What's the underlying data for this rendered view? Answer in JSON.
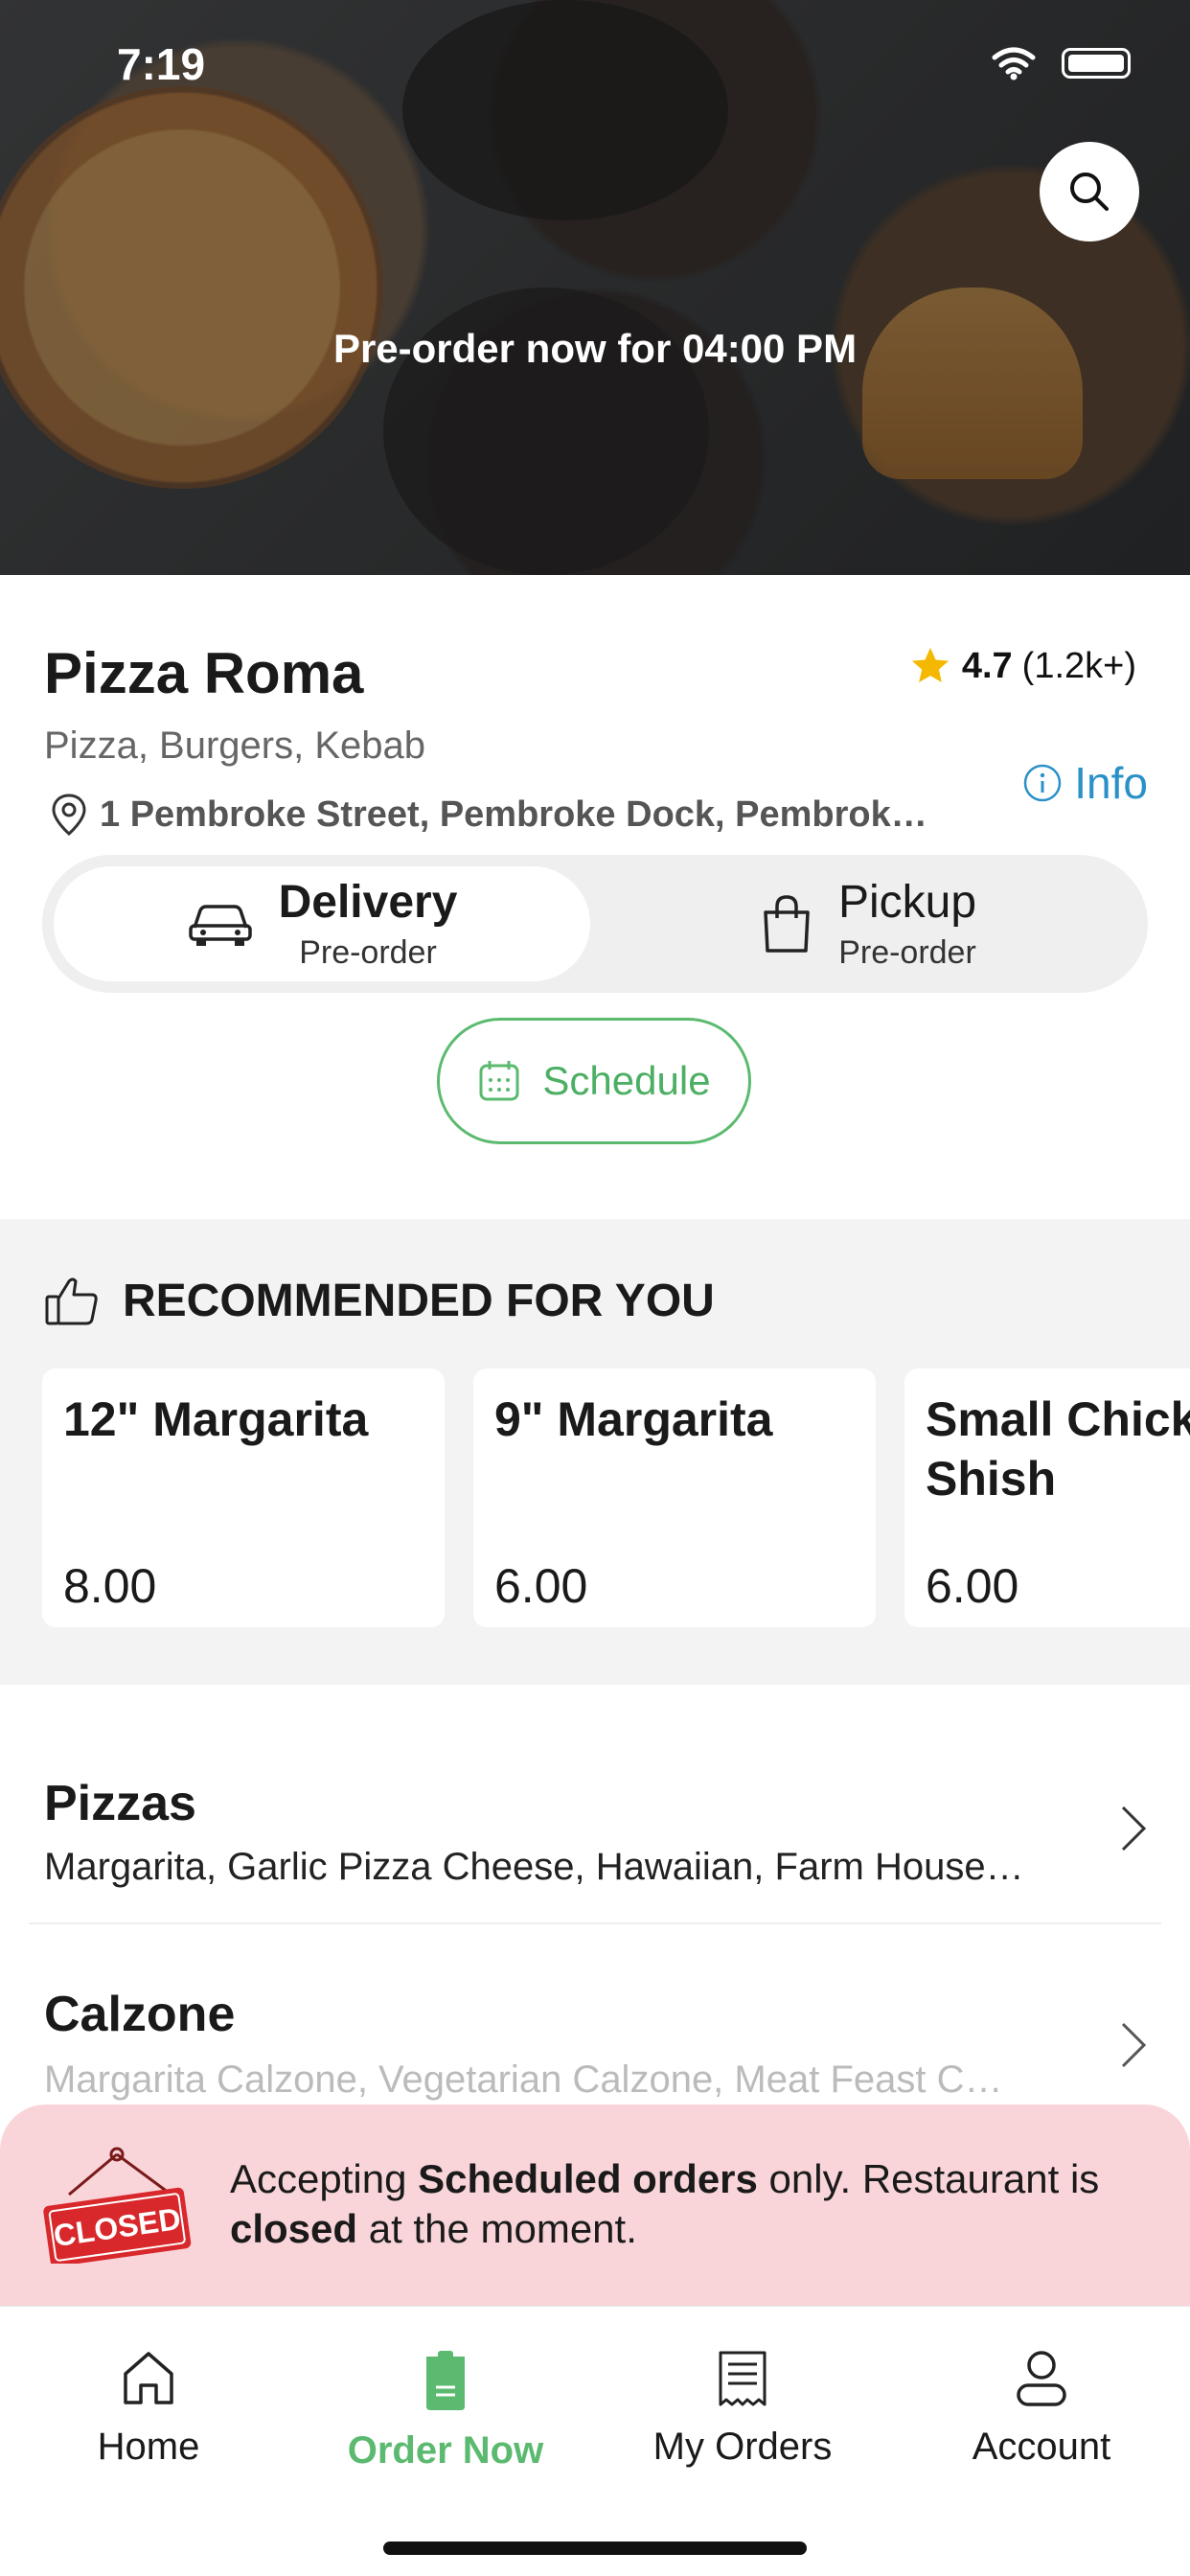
{
  "status": {
    "time": "7:19"
  },
  "hero": {
    "title": "Pre-order now for 04:00 PM"
  },
  "restaurant": {
    "name": "Pizza Roma",
    "rating": "4.7",
    "reviews": "(1.2k+)",
    "cuisines": "Pizza, Burgers, Kebab",
    "info_label": "Info",
    "address": "1 Pembroke Street, Pembroke Dock, Pembrok…"
  },
  "modes": [
    {
      "label": "Delivery",
      "sub": "Pre-order",
      "icon": "car-icon",
      "active": true
    },
    {
      "label": "Pickup",
      "sub": "Pre-order",
      "icon": "bag-icon",
      "active": false
    }
  ],
  "schedule_label": "Schedule",
  "recommended": {
    "title": "RECOMMENDED FOR YOU",
    "items": [
      {
        "name": "12\" Margarita",
        "price": "8.00"
      },
      {
        "name": "9\" Margarita",
        "price": "6.00"
      },
      {
        "name": "Small Chicken Shish",
        "price": "6.00"
      }
    ]
  },
  "categories": [
    {
      "title": "Pizzas",
      "items": "Margarita, Garlic Pizza Cheese, Hawaiian, Farm House…"
    },
    {
      "title": "Calzone",
      "items": "Margarita Calzone, Vegetarian Calzone, Meat Feast C…"
    }
  ],
  "closed_notice": {
    "sign_text": "CLOSED",
    "part1": "Accepting ",
    "bold1": "Scheduled orders",
    "part2": " only. Restaurant is ",
    "bold2": "closed",
    "part3": " at the moment."
  },
  "tabs": [
    {
      "label": "Home",
      "icon": "home-icon"
    },
    {
      "label": "Order Now",
      "icon": "order-icon",
      "active": true
    },
    {
      "label": "My Orders",
      "icon": "receipt-icon"
    },
    {
      "label": "Account",
      "icon": "user-icon"
    }
  ],
  "colors": {
    "accent_green": "#5bba6f",
    "info_blue": "#2a90c8",
    "closed_bg": "#f9d5da",
    "star": "#f5b800"
  }
}
